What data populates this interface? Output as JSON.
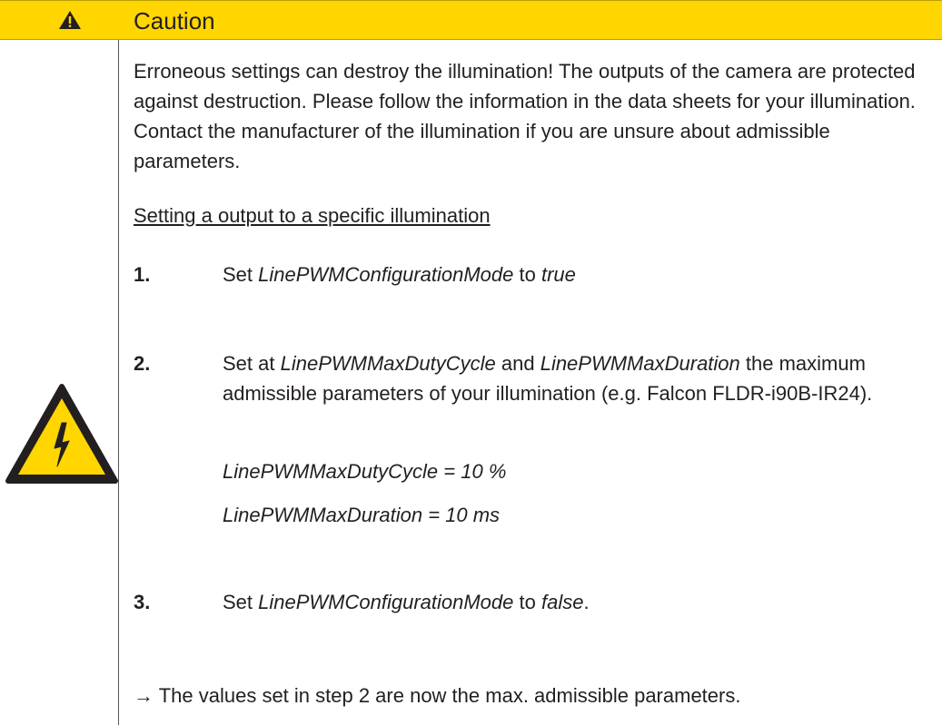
{
  "banner": {
    "title": "Caution",
    "icon": "warning-triangle-icon",
    "color": "#ffd600"
  },
  "side_icon": "electrical-hazard-icon",
  "intro": "Erroneous settings can destroy the illumination! The outputs of the camera are protected against destruction. Please follow the information in the data sheets for your illumination. Contact the manufacturer of the illumination if you are unsure about admissible parameters.",
  "procedure_heading": "Setting a output to a specific illumination",
  "steps": [
    {
      "number": "1.",
      "prefix": "Set ",
      "param": "LinePWMConfigurationMode",
      "mid": " to ",
      "value": "true",
      "suffix": ""
    },
    {
      "number": "2.",
      "prefix": "Set at ",
      "param_a": "LinePWMMaxDutyCycle",
      "and": " and ",
      "param_b": "LinePWMMaxDuration",
      "suffix": " the maximum admissible parameters of your illumination (e.g. Falcon FLDR-i90B-IR24).",
      "example_1": "LinePWMMaxDutyCycle = 10 %",
      "example_2": "LinePWMMaxDuration = 10 ms"
    },
    {
      "number": "3.",
      "prefix": "Set ",
      "param": "LinePWMConfigurationMode",
      "mid": " to ",
      "value": "false",
      "suffix": "."
    }
  ],
  "result": "→ The values set in step 2 are now the max. admissible parameters."
}
